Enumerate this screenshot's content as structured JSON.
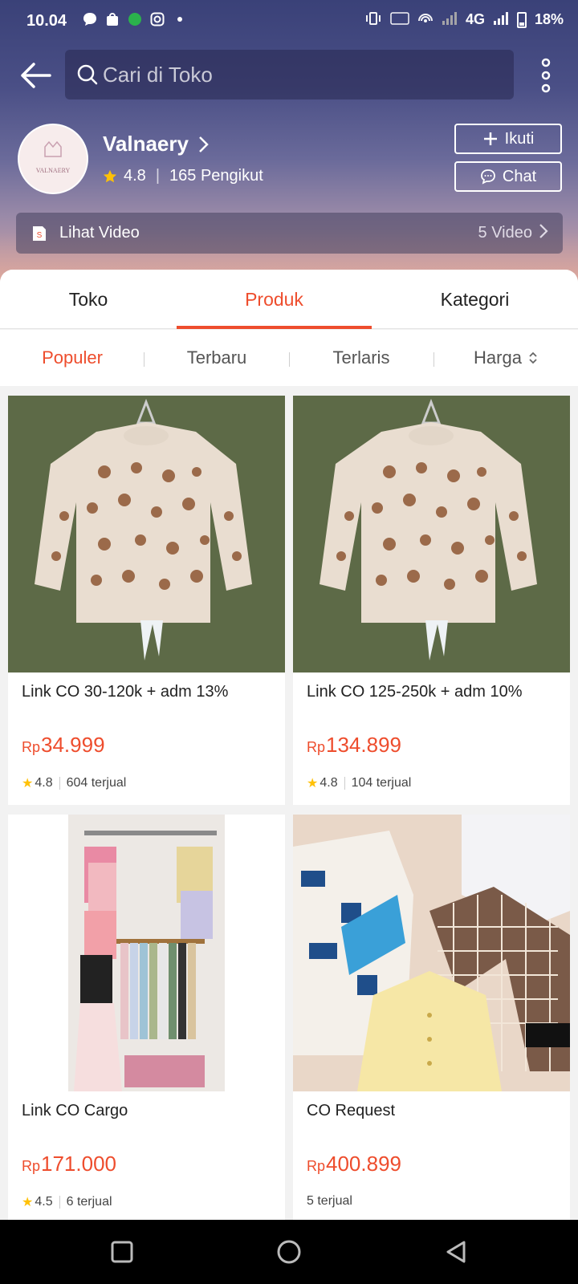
{
  "status_bar": {
    "time": "10.04",
    "network": "4G",
    "battery": "18%"
  },
  "search": {
    "placeholder": "Cari di Toko"
  },
  "shop": {
    "name": "Valnaery",
    "avatar_text": "VALNAERY",
    "rating": "4.8",
    "followers": "165 Pengikut",
    "follow_label": "Ikuti",
    "chat_label": "Chat"
  },
  "video_bar": {
    "label": "Lihat Video",
    "count": "5 Video"
  },
  "tabs": [
    {
      "label": "Toko"
    },
    {
      "label": "Produk",
      "active": true
    },
    {
      "label": "Kategori"
    }
  ],
  "sort_options": [
    {
      "label": "Populer",
      "active": true
    },
    {
      "label": "Terbaru"
    },
    {
      "label": "Terlaris"
    },
    {
      "label": "Harga"
    }
  ],
  "products": [
    {
      "title": "Link CO 30-120k + adm 13%",
      "currency": "Rp",
      "price": "34.999",
      "rating": "4.8",
      "sold": "604 terjual"
    },
    {
      "title": "Link CO 125-250k + adm 10%",
      "currency": "Rp",
      "price": "134.899",
      "rating": "4.8",
      "sold": "104 terjual"
    },
    {
      "title": "Link CO Cargo",
      "currency": "Rp",
      "price": "171.000",
      "rating": "4.5",
      "sold": "6 terjual"
    },
    {
      "title": "CO Request",
      "currency": "Rp",
      "price": "400.899",
      "rating": "",
      "sold": "5 terjual"
    }
  ],
  "colors": {
    "accent": "#ee4d2d",
    "star": "#ffc107"
  }
}
